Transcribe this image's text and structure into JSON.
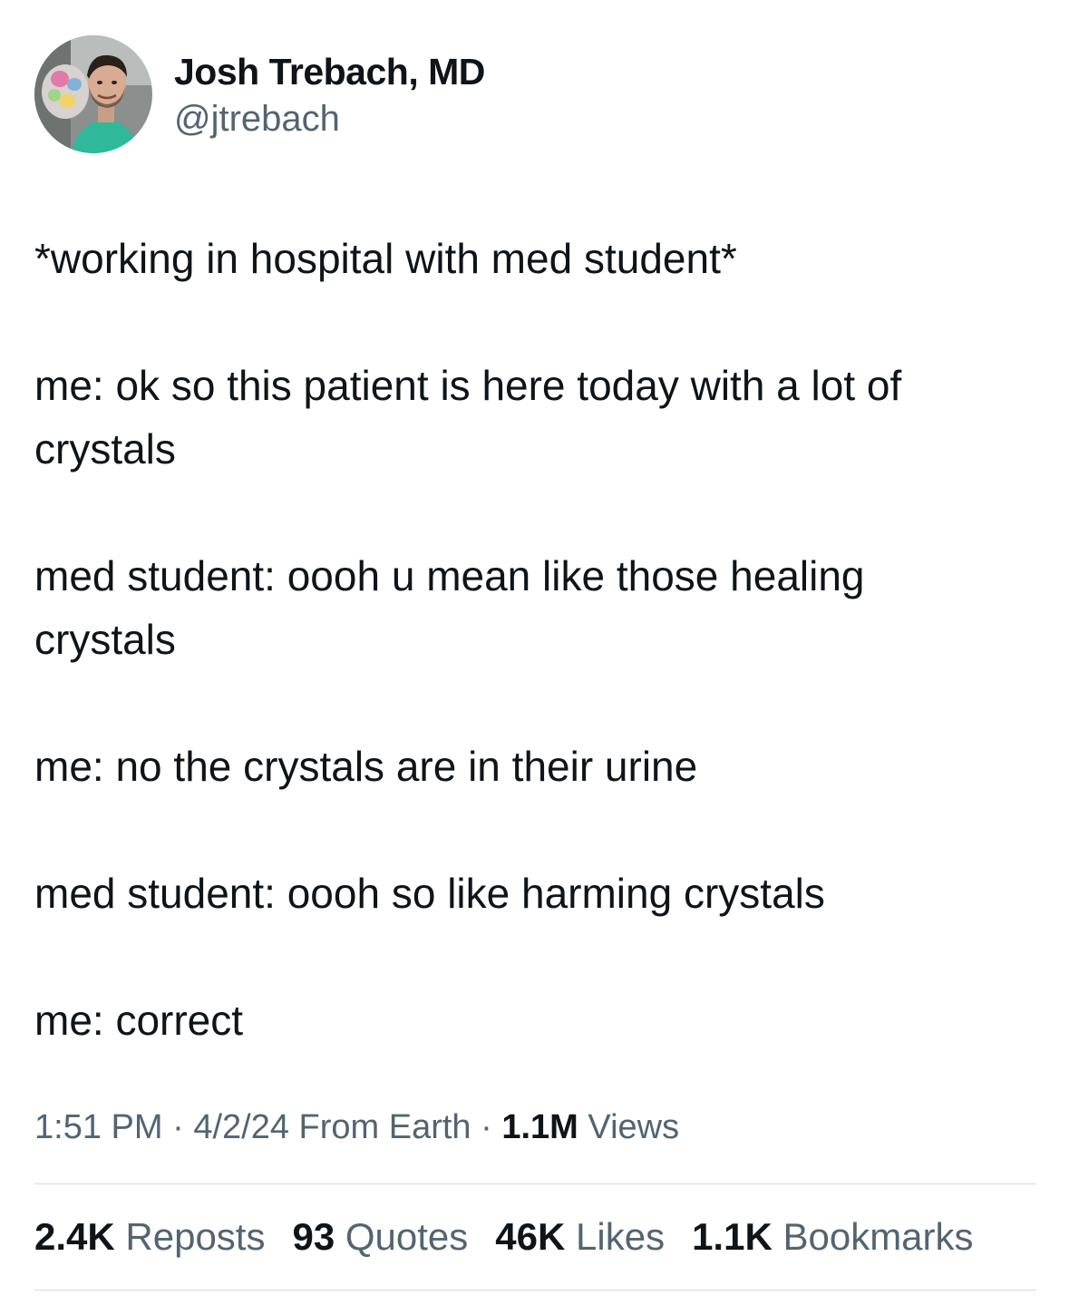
{
  "author": {
    "display_name": "Josh Trebach, MD",
    "handle": "@jtrebach",
    "avatar_icon": "profile-photo"
  },
  "tweet": {
    "paragraphs": [
      "*working in hospital with med student*",
      "me: ok so this patient is here today with a lot of\ncrystals",
      "med student: oooh u mean like those healing\ncrystals",
      "me: no the crystals are in their urine",
      "med student: oooh so like harming crystals",
      "me: correct"
    ]
  },
  "meta": {
    "time": "1:51 PM",
    "separator": "·",
    "date": "4/2/24",
    "source": "From Earth",
    "views_count": "1.1M",
    "views_label": "Views"
  },
  "stats": {
    "reposts_count": "2.4K",
    "reposts_label": "Reposts",
    "quotes_count": "93",
    "quotes_label": "Quotes",
    "likes_count": "46K",
    "likes_label": "Likes",
    "bookmarks_count": "1.1K",
    "bookmarks_label": "Bookmarks"
  },
  "colors": {
    "text_primary": "#0f1419",
    "text_secondary": "#536471",
    "divider": "#d6dade",
    "background": "#ffffff"
  }
}
